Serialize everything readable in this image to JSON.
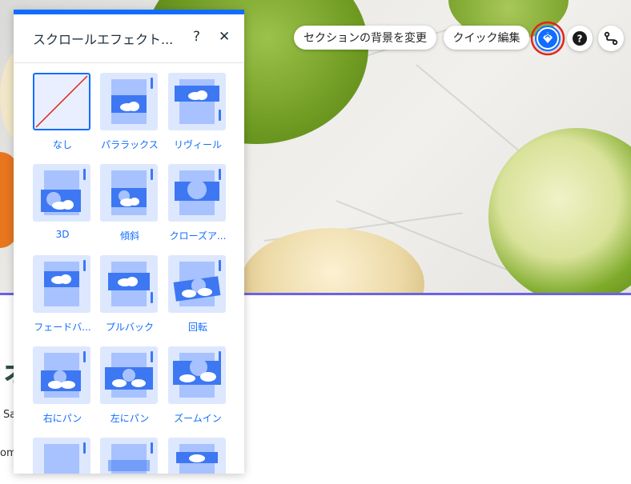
{
  "toolbar": {
    "change_bg_label": "セクションの背景を変更",
    "quick_edit_label": "クイック編集"
  },
  "panel": {
    "title": "スクロールエフェクト...",
    "help_label": "?",
    "close_label": "✕",
    "effects": [
      {
        "label": "なし",
        "selected": true
      },
      {
        "label": "パララックス"
      },
      {
        "label": "リヴィール"
      },
      {
        "label": "3D"
      },
      {
        "label": "傾斜"
      },
      {
        "label": "クローズア..."
      },
      {
        "label": "フェードバ..."
      },
      {
        "label": "プルバック"
      },
      {
        "label": "回転"
      },
      {
        "label": "右にパン"
      },
      {
        "label": "左にパン"
      },
      {
        "label": "ズームイン"
      },
      {
        "label": ""
      },
      {
        "label": ""
      },
      {
        "label": ""
      }
    ]
  },
  "page": {
    "text_sa": "Sa",
    "text_om": "om"
  },
  "colors": {
    "accent": "#116dff",
    "section_line": "#6b63e6",
    "highlight_ring": "#e0261b"
  },
  "icons": [
    "help-icon",
    "close-icon",
    "scroll-effect-icon",
    "connect-icon"
  ]
}
